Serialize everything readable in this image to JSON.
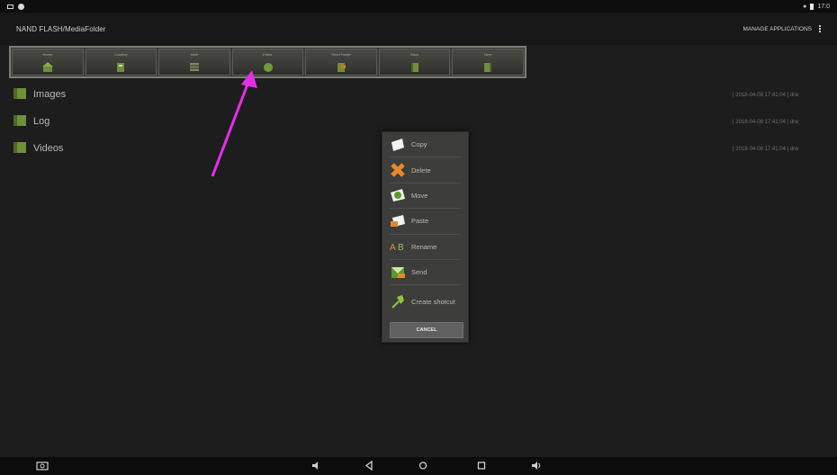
{
  "statusbar": {
    "time": "17:0"
  },
  "actionbar": {
    "path": "NAND FLASH/MediaFolder",
    "manage": "MANAGE APPLICATIONS"
  },
  "toolbar": {
    "buttons": [
      {
        "label": "Home",
        "icon": "home-icon"
      },
      {
        "label": "Loading",
        "icon": "loading-icon"
      },
      {
        "label": "Multi",
        "icon": "multi-icon"
      },
      {
        "label": "Editor",
        "icon": "editor-icon"
      },
      {
        "label": "Send Folder",
        "icon": "send-folder-icon"
      },
      {
        "label": "Back",
        "icon": "back-icon"
      },
      {
        "label": "Next",
        "icon": "next-icon"
      }
    ]
  },
  "files": [
    {
      "name": "Images",
      "time": "| 2018-04-08 17:41:04 | drw"
    },
    {
      "name": "Log",
      "time": "| 2018-04-08 17:41:04 | drw"
    },
    {
      "name": "Videos",
      "time": "| 2018-04-08 17:41:04 | drw"
    }
  ],
  "menu": {
    "items": [
      {
        "label": "Copy",
        "icon": "copy-icon"
      },
      {
        "label": "Delete",
        "icon": "delete-icon"
      },
      {
        "label": "Move",
        "icon": "move-icon"
      },
      {
        "label": "Paste",
        "icon": "paste-icon"
      },
      {
        "label": "Rename",
        "icon": "rename-icon"
      },
      {
        "label": "Send",
        "icon": "send-icon"
      },
      {
        "label": "Create shotcut",
        "icon": "shortcut-icon"
      }
    ],
    "cancel": "CANCEL"
  },
  "colors": {
    "folder": "#6f8f3a",
    "arrow": "#e62ee6",
    "background": "#1d1d1d"
  }
}
